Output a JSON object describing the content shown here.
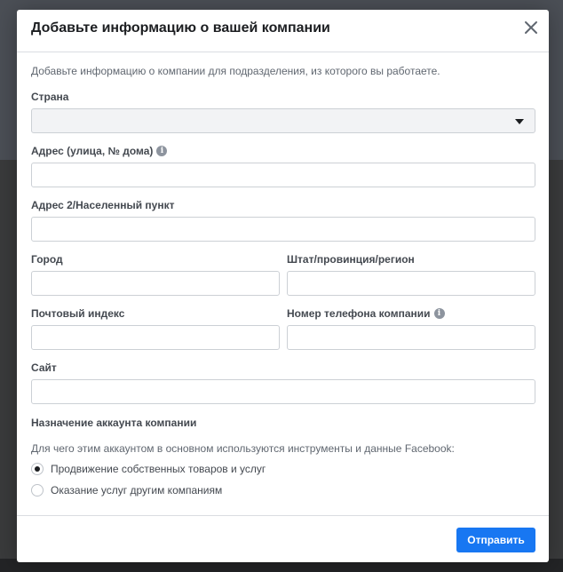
{
  "dialog": {
    "title": "Добавьте информацию о вашей компании",
    "close_icon": "close-icon",
    "intro": "Добавьте информацию о компании для подразделения, из которого вы работаете."
  },
  "form": {
    "country": {
      "label": "Страна",
      "value": ""
    },
    "address1": {
      "label": "Адрес (улица, № дома)",
      "value": "",
      "info_icon": "info-icon"
    },
    "address2": {
      "label": "Адрес 2/Населенный пункт",
      "value": ""
    },
    "city": {
      "label": "Город",
      "value": ""
    },
    "state": {
      "label": "Штат/провинция/регион",
      "value": ""
    },
    "zip": {
      "label": "Почтовый индекс",
      "value": ""
    },
    "phone": {
      "label": "Номер телефона компании",
      "value": "",
      "info_icon": "info-icon"
    },
    "website": {
      "label": "Сайт",
      "value": ""
    }
  },
  "purpose": {
    "title": "Назначение аккаунта компании",
    "question": "Для чего этим аккаунтом в основном используются инструменты и данные Facebook:",
    "options": [
      {
        "label": "Продвижение собственных товаров и услуг",
        "checked": true
      },
      {
        "label": "Оказание услуг другим компаниям",
        "checked": false
      }
    ]
  },
  "footer": {
    "submit_label": "Отправить"
  },
  "colors": {
    "accent": "#1877f2",
    "select_bg": "#f2f3f5",
    "border": "#ccd0d5"
  }
}
